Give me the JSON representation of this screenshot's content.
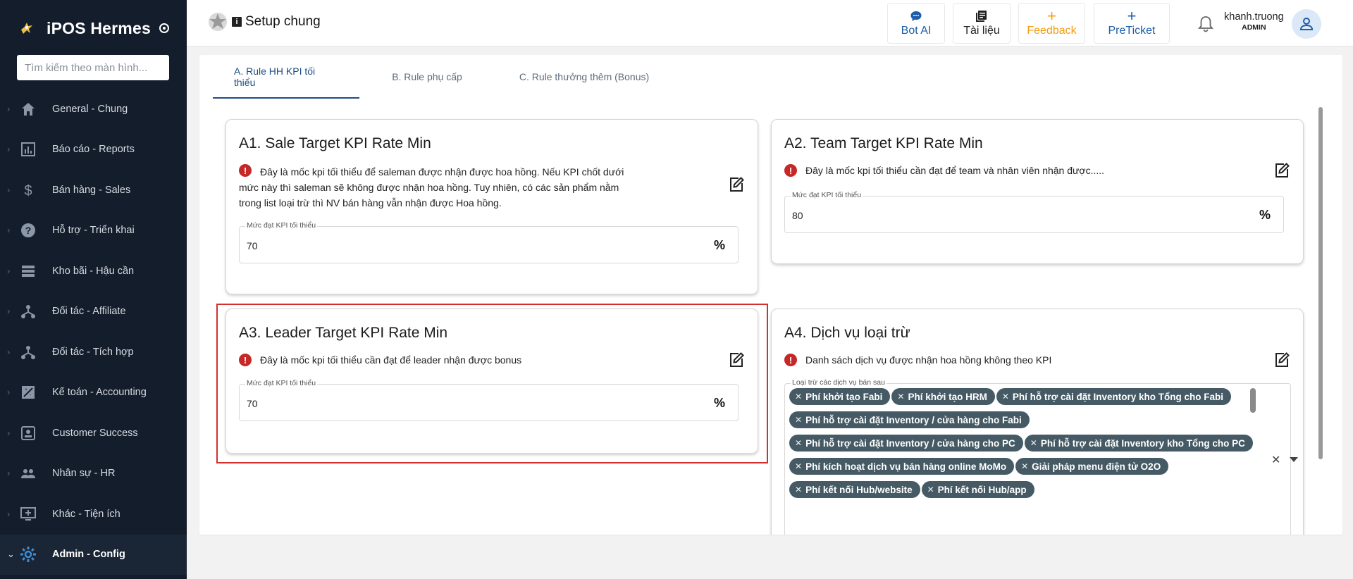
{
  "sidebar": {
    "brand": "iPOS Hermes",
    "search_placeholder": "Tìm kiếm theo màn hình...",
    "items": [
      {
        "label": "General - Chung",
        "icon": "home-icon"
      },
      {
        "label": "Báo cáo - Reports",
        "icon": "report-icon"
      },
      {
        "label": "Bán hàng - Sales",
        "icon": "dollar-icon"
      },
      {
        "label": "Hỗ trợ - Triển khai",
        "icon": "help-icon"
      },
      {
        "label": "Kho bãi - Hậu cần",
        "icon": "list-icon"
      },
      {
        "label": "Đối tác - Affiliate",
        "icon": "network-icon"
      },
      {
        "label": "Đối tác - Tích hợp",
        "icon": "network-icon"
      },
      {
        "label": "Kế toán - Accounting",
        "icon": "accounting-icon"
      },
      {
        "label": "Customer Success",
        "icon": "badge-icon"
      },
      {
        "label": "Nhân sự - HR",
        "icon": "people-icon"
      },
      {
        "label": "Khác - Tiện ích",
        "icon": "monitor-plus-icon"
      },
      {
        "label": "Admin - Config",
        "icon": "gear-icon",
        "active": true
      }
    ]
  },
  "header": {
    "title": "Setup chung",
    "buttons": [
      {
        "label": "Bot AI",
        "icon": "chat-icon",
        "color": "#1e5da8"
      },
      {
        "label": "Tài liệu",
        "icon": "docs-icon",
        "color": "#222222"
      },
      {
        "label": "Feedback",
        "icon": "plus-icon",
        "color": "#f39c12"
      },
      {
        "label": "PreTicket",
        "icon": "plus-icon",
        "color": "#1e5da8"
      }
    ],
    "user": {
      "name": "khanh.truong",
      "role": "ADMIN"
    }
  },
  "tabs": [
    "A. Rule HH KPI tối thiểu",
    "B. Rule phụ cấp",
    "C. Rule thưởng thêm (Bonus)"
  ],
  "cards": {
    "a1": {
      "title": "A1. Sale Target KPI Rate Min",
      "desc": "Đây là mốc kpi tối thiểu để saleman được nhận được hoa hồng. Nếu KPI chốt dưới mức này thì saleman sẽ không được nhận hoa hồng. Tuy nhiên, có các sản phẩm nằm trong list loại trừ thì NV bán hàng vẫn nhận được Hoa hồng.",
      "field_label": "Mức đạt KPI tối thiểu",
      "value": "70",
      "unit": "%"
    },
    "a2": {
      "title": "A2. Team Target KPI Rate Min",
      "desc": "Đây là mốc kpi tối thiểu cần đạt để team và nhân viên nhận được.....",
      "field_label": "Mức đạt KPI tối thiểu",
      "value": "80",
      "unit": "%"
    },
    "a3": {
      "title": "A3. Leader Target KPI Rate Min",
      "desc": "Đây là mốc kpi tối thiểu cần đạt để leader nhận được bonus",
      "field_label": "Mức đạt KPI tối thiểu",
      "value": "70",
      "unit": "%"
    },
    "a4": {
      "title": "A4. Dịch vụ loại trừ",
      "desc": "Danh sách dịch vụ được nhận hoa hồng không theo KPI",
      "field_label": "Loại trừ các dịch vụ bán sau",
      "chips": [
        "Phí khởi tạo Fabi",
        "Phí khởi tạo HRM",
        "Phí hỗ trợ cài đặt Inventory kho Tổng cho Fabi",
        "Phí hỗ trợ cài đặt Inventory / cửa hàng cho Fabi",
        "Phí hỗ trợ cài đặt Inventory / cửa hàng cho PC",
        "Phí hỗ trợ cài đặt Inventory kho Tổng cho PC",
        "Phí kích hoạt dịch vụ bán hàng online MoMo",
        "Giải pháp menu điện tử O2O",
        "Phí kết nối Hub/website",
        "Phí kết nối Hub/app"
      ]
    }
  }
}
